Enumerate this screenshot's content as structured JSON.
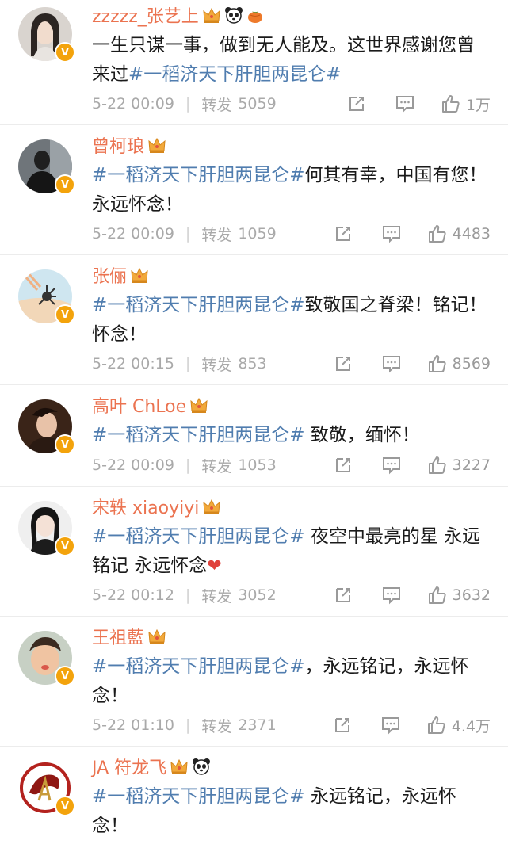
{
  "comments": [
    {
      "username": "zzzzz_张艺上",
      "badges": [
        "crown-icon",
        "panda-icon",
        "tangerine-icon"
      ],
      "text_plain": "一生只谋一事，做到无人能及。这世界感谢您曾来过",
      "hashtag": "#一稻济天下肝胆两昆仑#",
      "text_after": "",
      "timestamp": "5-22 00:09",
      "repost_label": "转发",
      "repost_count": "5059",
      "likes": "1万"
    },
    {
      "username": "曾柯琅",
      "badges": [
        "crown-icon"
      ],
      "text_plain": "",
      "hashtag": "#一稻济天下肝胆两昆仑#",
      "text_after": "何其有幸，中国有您！永远怀念！",
      "timestamp": "5-22 00:09",
      "repost_label": "转发",
      "repost_count": "1059",
      "likes": "4483"
    },
    {
      "username": "张俪",
      "badges": [
        "crown-icon"
      ],
      "text_plain": "",
      "hashtag": "#一稻济天下肝胆两昆仑#",
      "text_after": "致敬国之脊梁！铭记！怀念！",
      "timestamp": "5-22 00:15",
      "repost_label": "转发",
      "repost_count": "853",
      "likes": "8569"
    },
    {
      "username": "高叶 ChLoe",
      "badges": [
        "crown-icon"
      ],
      "text_plain": "",
      "hashtag": "#一稻济天下肝胆两昆仑#",
      "text_after": " 致敬，缅怀！",
      "timestamp": "5-22 00:09",
      "repost_label": "转发",
      "repost_count": "1053",
      "likes": "3227"
    },
    {
      "username": "宋轶 xiaoyiyi",
      "badges": [
        "crown-icon"
      ],
      "text_plain": "",
      "hashtag": "#一稻济天下肝胆两昆仑#",
      "text_after": " 夜空中最亮的星 永远铭记 永远怀念",
      "emoji": "❤",
      "timestamp": "5-22 00:12",
      "repost_label": "转发",
      "repost_count": "3052",
      "likes": "3632"
    },
    {
      "username": "王祖藍",
      "badges": [
        "crown-icon"
      ],
      "text_plain": "",
      "hashtag": "#一稻济天下肝胆两昆仑#",
      "text_after": "，永远铭记，永远怀念！",
      "timestamp": "5-22 01:10",
      "repost_label": "转发",
      "repost_count": "2371",
      "likes": "4.4万"
    },
    {
      "username": "JA 符龙飞",
      "badges": [
        "crown-icon",
        "panda-icon"
      ],
      "text_plain": "",
      "hashtag": "#一稻济天下肝胆两昆仑#",
      "text_after": " 永远铭记，永远怀念！",
      "timestamp": "",
      "repost_label": "",
      "repost_count": "",
      "likes": ""
    }
  ],
  "verified_badge": "V",
  "colors": {
    "username": "#eb7350",
    "hashtag": "#507daf",
    "meta": "#a9a9a9",
    "verified": "#f3a30c",
    "crown": "#f2a93b",
    "heart": "#e0423c"
  }
}
